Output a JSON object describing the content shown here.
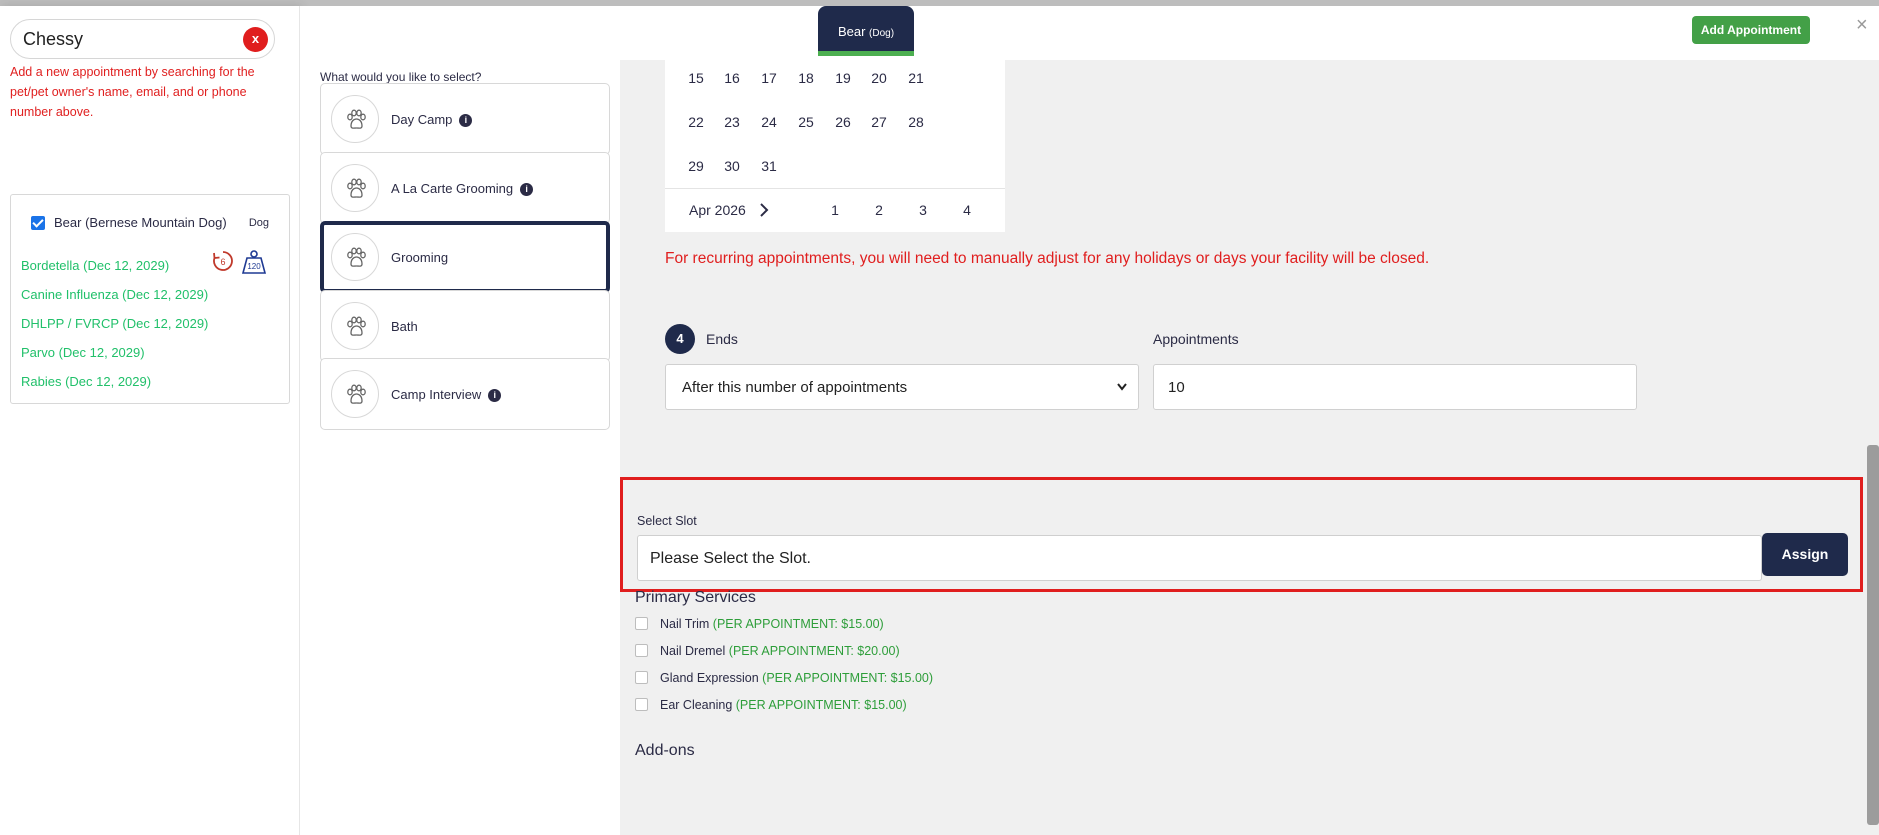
{
  "search": {
    "value": "Chessy",
    "clear_label": "x",
    "hint": "Add a new appointment by searching for the pet/pet owner's name, email, and or phone number above."
  },
  "pet": {
    "name": "Bear (Bernese Mountain Dog)",
    "type": "Dog",
    "cycle_count": "6",
    "weight": "120",
    "vaccinations": [
      "Bordetella (Dec 12, 2029)",
      "Canine Influenza (Dec 12, 2029)",
      "DHLPP / FVRCP (Dec 12, 2029)",
      "Parvo (Dec 12, 2029)",
      "Rabies (Dec 12, 2029)"
    ]
  },
  "header": {
    "pet_tab_name": "Bear",
    "pet_tab_type": "(Dog)",
    "add_appointment_label": "Add Appointment",
    "close_label": "×"
  },
  "services": {
    "question": "What would you like to select?",
    "items": [
      {
        "label": "Day Camp",
        "info": true
      },
      {
        "label": "A La Carte Grooming",
        "info": true
      },
      {
        "label": "Grooming",
        "info": false,
        "selected": true
      },
      {
        "label": "Bath",
        "info": false
      },
      {
        "label": "Camp Interview",
        "info": true
      }
    ]
  },
  "calendar": {
    "weeks": [
      [
        "15",
        "16",
        "17",
        "18",
        "19",
        "20",
        "21"
      ],
      [
        "22",
        "23",
        "24",
        "25",
        "26",
        "27",
        "28"
      ],
      [
        "29",
        "30",
        "31",
        "",
        "",
        "",
        ""
      ]
    ],
    "next_month_label": "Apr 2026",
    "next_month_days": [
      "1",
      "2",
      "3",
      "4"
    ]
  },
  "recurring_note": "For recurring appointments, you will need to manually adjust for any holidays or days your facility will be closed.",
  "ends": {
    "step": "4",
    "label": "Ends",
    "selected": "After this number of appointments",
    "appointments_label": "Appointments",
    "appointments_value": "10"
  },
  "slot": {
    "label": "Select Slot",
    "placeholder": "Please Select the Slot.",
    "assign_label": "Assign"
  },
  "primary_services": {
    "title": "Primary Services",
    "items": [
      {
        "name": "Nail Trim",
        "price": "(PER APPOINTMENT: $15.00)"
      },
      {
        "name": "Nail Dremel",
        "price": "(PER APPOINTMENT: $20.00)"
      },
      {
        "name": "Gland Expression",
        "price": "(PER APPOINTMENT: $15.00)"
      },
      {
        "name": "Ear Cleaning",
        "price": "(PER APPOINTMENT: $15.00)"
      }
    ]
  },
  "addons_title": "Add-ons",
  "colors": {
    "navy": "#1f2a4b",
    "green_button": "#43a047",
    "alert_red": "#e01e1e",
    "vaccine_green": "#21c06a",
    "price_green": "#2e9e3a"
  }
}
